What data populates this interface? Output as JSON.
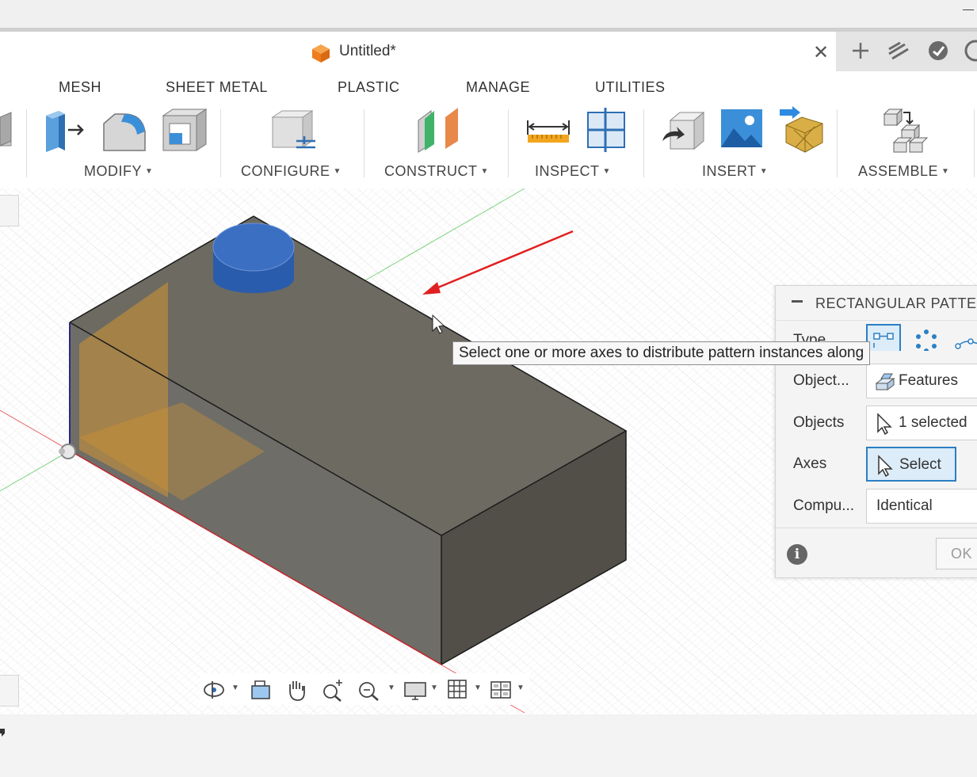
{
  "document": {
    "title": "Untitled*"
  },
  "ribbon": {
    "tabs": [
      "MESH",
      "SHEET METAL",
      "PLASTIC",
      "MANAGE",
      "UTILITIES"
    ],
    "groups": {
      "modify": "MODIFY",
      "configure": "CONFIGURE",
      "construct": "CONSTRUCT",
      "inspect": "INSPECT",
      "insert": "INSERT",
      "assemble": "ASSEMBLE"
    }
  },
  "tooltip": {
    "text": "Select one or more axes to distribute pattern instances along"
  },
  "dialog": {
    "title": "RECTANGULAR PATTE",
    "type_label": "Type",
    "rows": {
      "object_type": {
        "label": "Object...",
        "value": "Features"
      },
      "objects": {
        "label": "Objects",
        "value": "1 selected"
      },
      "axes": {
        "label": "Axes",
        "value": "Select"
      },
      "compute": {
        "label": "Compu...",
        "value": "Identical"
      }
    },
    "ok_label": "OK",
    "info_glyph": "i"
  },
  "icons": {
    "tab_tools": [
      "plus-icon",
      "extensions-icon",
      "job-status-icon",
      "notifications-icon"
    ],
    "navbar": [
      "orbit-icon",
      "look-at-icon",
      "pan-icon",
      "zoom-icon",
      "fit-icon",
      "display-settings-icon",
      "grid-icon",
      "viewports-icon"
    ]
  },
  "colors": {
    "accent": "#2b7fc4",
    "selection_active_bg": "#dcecf8",
    "annotation_arrow": "#e02020",
    "body": "#6b6860",
    "feature_blue": "#2f63b0",
    "plane_orange": "#d9972d"
  }
}
